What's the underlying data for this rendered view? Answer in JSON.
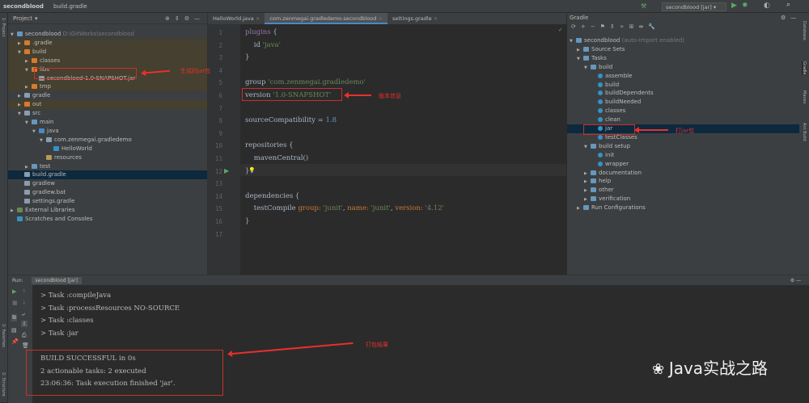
{
  "breadcrumb": [
    "secondblood",
    "build.gradle"
  ],
  "run_config": "secondblood [jar]",
  "left_stripe": {
    "project": "1: Project",
    "favorites": "2: Favorites",
    "structure": "2: Structure"
  },
  "right_stripe": [
    "Database",
    "Gradle",
    "Maven",
    "Ant Build"
  ],
  "project": {
    "title": "Project",
    "tree": [
      {
        "label": "secondblood",
        "extra": "D:\\GitWorks\\secondblood",
        "depth": 0,
        "arrow": "▼",
        "color": "#6897bb",
        "ex": false
      },
      {
        "label": ".gradle",
        "depth": 1,
        "arrow": "▶",
        "color": "#d97a2b",
        "ex": true
      },
      {
        "label": "build",
        "depth": 1,
        "arrow": "▼",
        "color": "#d97a2b",
        "ex": true
      },
      {
        "label": "classes",
        "depth": 2,
        "arrow": "▶",
        "color": "#d97a2b",
        "ex": true
      },
      {
        "label": "libs",
        "depth": 2,
        "arrow": "▼",
        "color": "#d97a2b",
        "ex": true
      },
      {
        "label": "secondblood-1.0-SNAPSHOT.jar",
        "depth": 3,
        "arrow": "",
        "color": "#8a9db0",
        "ex": true
      },
      {
        "label": "tmp",
        "depth": 2,
        "arrow": "▶",
        "color": "#d97a2b",
        "ex": true
      },
      {
        "label": "gradle",
        "depth": 1,
        "arrow": "▶",
        "color": "#8a9db0",
        "ex": false
      },
      {
        "label": "out",
        "depth": 1,
        "arrow": "▶",
        "color": "#d97a2b",
        "ex": true
      },
      {
        "label": "src",
        "depth": 1,
        "arrow": "▼",
        "color": "#8a9db0",
        "ex": false
      },
      {
        "label": "main",
        "depth": 2,
        "arrow": "▼",
        "color": "#6897bb",
        "ex": false
      },
      {
        "label": "java",
        "depth": 3,
        "arrow": "▼",
        "color": "#4a88c7",
        "ex": false
      },
      {
        "label": "com.zenmegai.gradledemo",
        "depth": 4,
        "arrow": "▼",
        "color": "#8a9db0",
        "ex": false
      },
      {
        "label": "HelloWorld",
        "depth": 5,
        "arrow": "",
        "color": "#3592c4",
        "ex": false
      },
      {
        "label": "resources",
        "depth": 4,
        "arrow": "",
        "color": "#b59a5a",
        "ex": false
      },
      {
        "label": "test",
        "depth": 2,
        "arrow": "▶",
        "color": "#6897bb",
        "ex": false
      },
      {
        "label": "build.gradle",
        "depth": 1,
        "arrow": "",
        "color": "#8a9db0",
        "ex": false,
        "sel": true
      },
      {
        "label": "gradlew",
        "depth": 1,
        "arrow": "",
        "color": "#8a9db0",
        "ex": false
      },
      {
        "label": "gradlew.bat",
        "depth": 1,
        "arrow": "",
        "color": "#8a9db0",
        "ex": false
      },
      {
        "label": "settings.gradle",
        "depth": 1,
        "arrow": "",
        "color": "#8a9db0",
        "ex": false
      },
      {
        "label": "External Libraries",
        "depth": 0,
        "arrow": "▶",
        "color": "#6a8759",
        "ex": false
      },
      {
        "label": "Scratches and Consoles",
        "depth": 0,
        "arrow": "",
        "color": "#3592c4",
        "ex": false
      }
    ]
  },
  "editor": {
    "tabs": [
      "HelloWorld.java",
      "com.zenmegai.gradledemo.secondblood",
      "settings.gradle"
    ],
    "active_tab": 1,
    "lines": [
      "<span class='nm'>plugins</span> {",
      "    id <span class='str'>'java'</span>",
      "}",
      "",
      "group <span class='str'>'com.zenmegai.gradledemo'</span>",
      "version <span class='str'>'1.0-SNAPSHOT'</span>",
      "",
      "sourceCompatibility = <span class='num'>1.8</span>",
      "",
      "repositories {",
      "    mavenCentral()",
      "}",
      "",
      "dependencies {",
      "    testCompile <span class='kw'>group:</span> <span class='str'>'junit'</span>, <span class='kw'>name:</span> <span class='str'>'junit'</span>, <span class='kw'>version:</span> <span class='str'>'4.12'</span>",
      "}",
      ""
    ]
  },
  "gradle": {
    "title": "Gradle",
    "tree": [
      {
        "label": "secondblood",
        "extra": "(auto-import enabled)",
        "depth": 0,
        "arrow": "▼",
        "type": "proj"
      },
      {
        "label": "Source Sets",
        "depth": 1,
        "arrow": "▶",
        "type": "folder"
      },
      {
        "label": "Tasks",
        "depth": 1,
        "arrow": "▼",
        "type": "folder"
      },
      {
        "label": "build",
        "depth": 2,
        "arrow": "▼",
        "type": "folder"
      },
      {
        "label": "assemble",
        "depth": 3,
        "arrow": "",
        "type": "task"
      },
      {
        "label": "build",
        "depth": 3,
        "arrow": "",
        "type": "task"
      },
      {
        "label": "buildDependents",
        "depth": 3,
        "arrow": "",
        "type": "task"
      },
      {
        "label": "buildNeeded",
        "depth": 3,
        "arrow": "",
        "type": "task"
      },
      {
        "label": "classes",
        "depth": 3,
        "arrow": "",
        "type": "task"
      },
      {
        "label": "clean",
        "depth": 3,
        "arrow": "",
        "type": "task"
      },
      {
        "label": "jar",
        "depth": 3,
        "arrow": "",
        "type": "task",
        "sel": true
      },
      {
        "label": "testClasses",
        "depth": 3,
        "arrow": "",
        "type": "task"
      },
      {
        "label": "build setup",
        "depth": 2,
        "arrow": "▼",
        "type": "folder"
      },
      {
        "label": "init",
        "depth": 3,
        "arrow": "",
        "type": "task"
      },
      {
        "label": "wrapper",
        "depth": 3,
        "arrow": "",
        "type": "task"
      },
      {
        "label": "documentation",
        "depth": 2,
        "arrow": "▶",
        "type": "folder"
      },
      {
        "label": "help",
        "depth": 2,
        "arrow": "▶",
        "type": "folder"
      },
      {
        "label": "other",
        "depth": 2,
        "arrow": "▶",
        "type": "folder"
      },
      {
        "label": "verification",
        "depth": 2,
        "arrow": "▶",
        "type": "folder"
      },
      {
        "label": "Run Configurations",
        "depth": 1,
        "arrow": "▶",
        "type": "folder"
      }
    ]
  },
  "run": {
    "label": "Run:",
    "tab": "secondblood [jar]",
    "tasks": [
      "> Task :compileJava",
      "> Task :processResources NO-SOURCE",
      "> Task :classes",
      "> Task :jar"
    ],
    "result": [
      "BUILD SUCCESSFUL in 0s",
      "2 actionable tasks: 2 executed",
      "23:06:36: Task execution finished 'jar'."
    ]
  },
  "annotations": {
    "jar_generated": "生成的jar包",
    "version_info": "版本信息",
    "build_jar": "打jar包",
    "build_result": "打包结果"
  },
  "watermark": "Java实战之路"
}
